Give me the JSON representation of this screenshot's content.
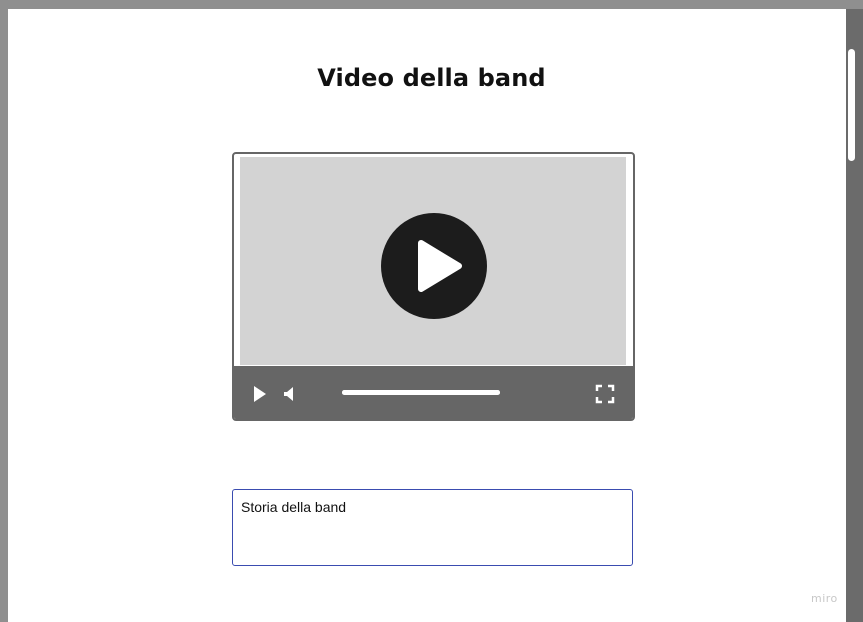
{
  "page": {
    "title": "Video della band"
  },
  "video_player": {
    "progress_percent": 100,
    "icons": {
      "big_play": "play-circle-icon",
      "play": "play-icon",
      "mute": "speaker-icon",
      "fullscreen": "fullscreen-icon"
    },
    "colors": {
      "video_background": "#d3d3d3",
      "control_bar": "#666666",
      "play_button": "#1c1c1c"
    }
  },
  "story_field": {
    "value": "Storia della band"
  },
  "watermark": {
    "text": "miro"
  }
}
